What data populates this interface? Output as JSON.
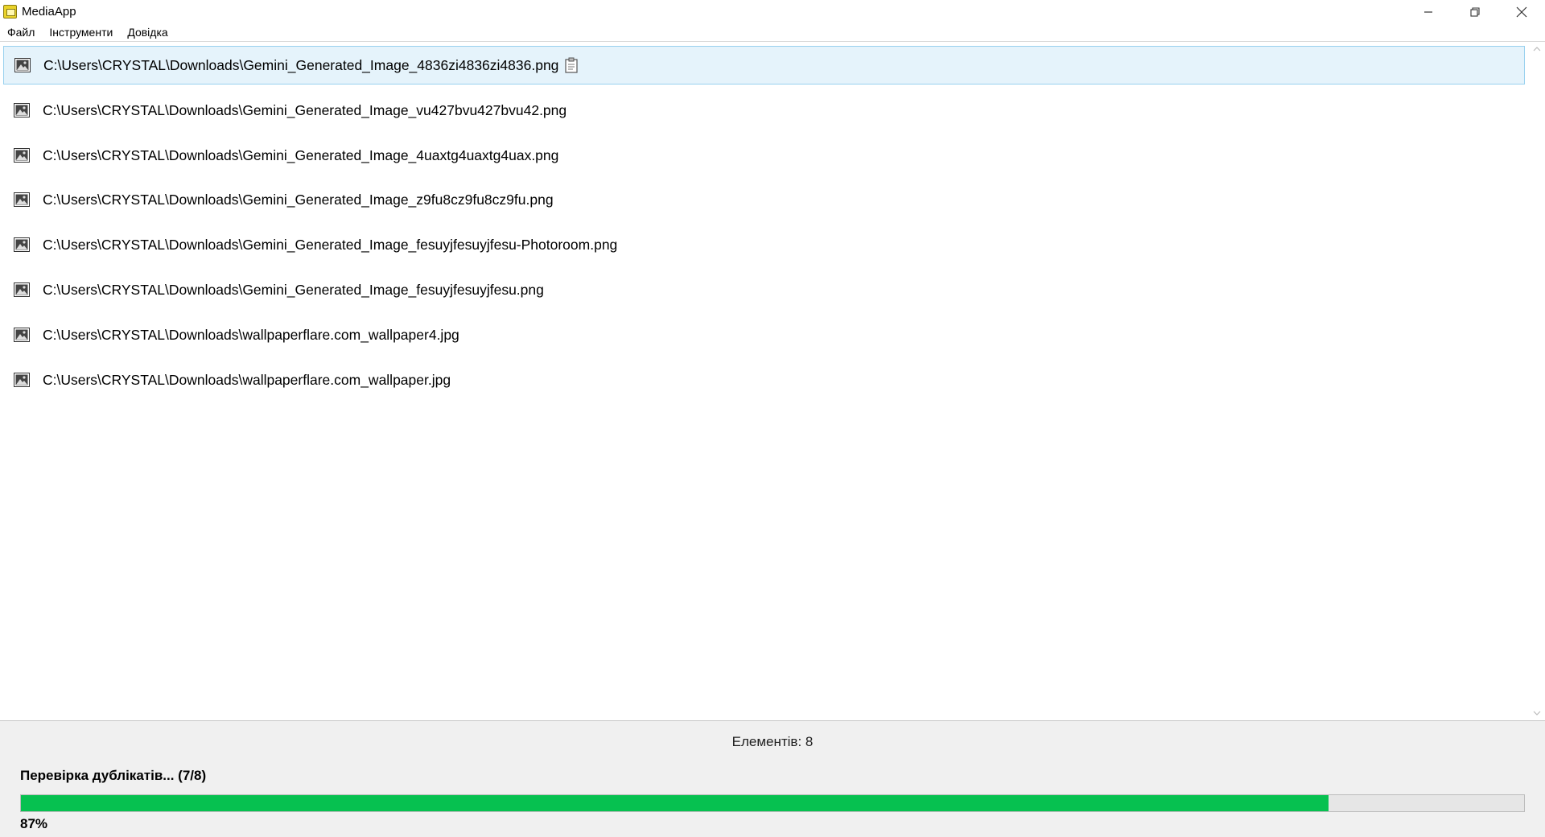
{
  "window": {
    "title": "MediaApp",
    "controls": {
      "minimize": "minimize-icon",
      "restore": "restore-icon",
      "close": "close-icon"
    }
  },
  "menu": {
    "items": [
      {
        "label": "Файл"
      },
      {
        "label": "Інструменти"
      },
      {
        "label": "Довідка"
      }
    ]
  },
  "files": {
    "selected_index": 0,
    "items": [
      {
        "path": "C:\\Users\\CRYSTAL\\Downloads\\Gemini_Generated_Image_4836zi4836zi4836.png"
      },
      {
        "path": "C:\\Users\\CRYSTAL\\Downloads\\Gemini_Generated_Image_vu427bvu427bvu42.png"
      },
      {
        "path": "C:\\Users\\CRYSTAL\\Downloads\\Gemini_Generated_Image_4uaxtg4uaxtg4uax.png"
      },
      {
        "path": "C:\\Users\\CRYSTAL\\Downloads\\Gemini_Generated_Image_z9fu8cz9fu8cz9fu.png"
      },
      {
        "path": "C:\\Users\\CRYSTAL\\Downloads\\Gemini_Generated_Image_fesuyjfesuyjfesu-Photoroom.png"
      },
      {
        "path": "C:\\Users\\CRYSTAL\\Downloads\\Gemini_Generated_Image_fesuyjfesuyjfesu.png"
      },
      {
        "path": "C:\\Users\\CRYSTAL\\Downloads\\wallpaperflare.com_wallpaper4.jpg"
      },
      {
        "path": "C:\\Users\\CRYSTAL\\Downloads\\wallpaperflare.com_wallpaper.jpg"
      }
    ]
  },
  "status": {
    "count_label": "Елементів: 8",
    "task_label": "Перевірка дублікатів... (7/8)",
    "progress_percent": 87,
    "percent_label": "87%"
  },
  "colors": {
    "progress_fill": "#06c150",
    "selection_bg": "#e5f3fb",
    "selection_border": "#99d1ef"
  }
}
